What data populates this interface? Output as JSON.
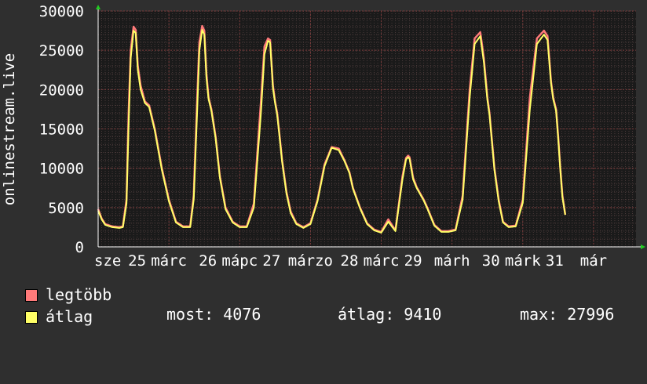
{
  "chart_data": {
    "type": "area",
    "ylabel": "onlinestream.live",
    "ylim": [
      0,
      30000
    ],
    "yticks": [
      0,
      5000,
      10000,
      15000,
      20000,
      25000,
      30000
    ],
    "xlim": [
      0,
      7.6
    ],
    "x_tick_labels": [
      {
        "x": 0.0,
        "label": "sze"
      },
      {
        "x": 0.55,
        "label": "25"
      },
      {
        "x": 1.0,
        "label": "márc"
      },
      {
        "x": 1.55,
        "label": "26"
      },
      {
        "x": 2.0,
        "label": "mápc"
      },
      {
        "x": 2.45,
        "label": "27"
      },
      {
        "x": 3.0,
        "label": "márzo"
      },
      {
        "x": 3.55,
        "label": "28"
      },
      {
        "x": 4.0,
        "label": "márc"
      },
      {
        "x": 4.45,
        "label": "29"
      },
      {
        "x": 5.0,
        "label": "márh"
      },
      {
        "x": 5.55,
        "label": "30"
      },
      {
        "x": 6.0,
        "label": "márk"
      },
      {
        "x": 6.45,
        "label": "31"
      },
      {
        "x": 7.0,
        "label": "már"
      }
    ],
    "x": [
      0.0,
      0.05,
      0.1,
      0.2,
      0.3,
      0.35,
      0.4,
      0.43,
      0.46,
      0.5,
      0.53,
      0.56,
      0.6,
      0.66,
      0.72,
      0.8,
      0.9,
      1.0,
      1.1,
      1.2,
      1.3,
      1.35,
      1.4,
      1.43,
      1.47,
      1.5,
      1.53,
      1.56,
      1.6,
      1.66,
      1.72,
      1.8,
      1.9,
      2.0,
      2.1,
      2.2,
      2.3,
      2.35,
      2.4,
      2.43,
      2.47,
      2.5,
      2.53,
      2.56,
      2.6,
      2.66,
      2.72,
      2.8,
      2.9,
      3.0,
      3.1,
      3.2,
      3.3,
      3.4,
      3.48,
      3.55,
      3.6,
      3.7,
      3.8,
      3.9,
      4.0,
      4.1,
      4.2,
      4.3,
      4.35,
      4.38,
      4.4,
      4.45,
      4.5,
      4.55,
      4.6,
      4.65,
      4.75,
      4.85,
      4.95,
      5.05,
      5.15,
      5.25,
      5.32,
      5.4,
      5.45,
      5.5,
      5.53,
      5.56,
      5.6,
      5.66,
      5.72,
      5.8,
      5.9,
      6.0,
      6.1,
      6.2,
      6.3,
      6.35,
      6.4,
      6.43,
      6.47,
      6.5,
      6.53,
      6.56,
      6.6,
      6.66,
      6.72,
      6.8,
      6.9,
      7.0,
      7.1
    ],
    "series": [
      {
        "name": "legtöbb",
        "color": "#ff7a7a",
        "values": [
          4800,
          3600,
          2900,
          2600,
          2500,
          2600,
          6000,
          17000,
          25000,
          28000,
          27600,
          23000,
          20500,
          18500,
          18000,
          15000,
          10000,
          6000,
          3200,
          2600,
          2600,
          6500,
          19000,
          26000,
          28100,
          27500,
          22000,
          19000,
          17500,
          14000,
          9000,
          5000,
          3200,
          2600,
          2600,
          5500,
          18500,
          25500,
          26500,
          26300,
          20500,
          18500,
          17000,
          14500,
          11000,
          7000,
          4500,
          3000,
          2500,
          3000,
          6000,
          10500,
          12700,
          12500,
          11000,
          9500,
          7500,
          5000,
          3000,
          2200,
          1900,
          3500,
          2100,
          9000,
          11300,
          11600,
          11400,
          8800,
          7600,
          6800,
          6000,
          5000,
          2800,
          2000,
          2000,
          2200,
          6500,
          20000,
          26500,
          27300,
          24000,
          19000,
          17000,
          14000,
          10000,
          6000,
          3200,
          2600,
          2700,
          6000,
          19000,
          26500,
          27500,
          26800,
          21000,
          19000,
          17500,
          14000,
          10000,
          6500,
          4100
        ]
      },
      {
        "name": "átlag",
        "color": "#ffff66",
        "values": [
          4600,
          3500,
          2800,
          2500,
          2400,
          2500,
          5500,
          15500,
          24000,
          27500,
          27200,
          22500,
          20000,
          18300,
          17800,
          14800,
          9800,
          5800,
          3100,
          2500,
          2500,
          6000,
          17500,
          25000,
          27600,
          27000,
          21500,
          18800,
          17300,
          13800,
          8800,
          4800,
          3100,
          2500,
          2500,
          5000,
          17000,
          24500,
          26200,
          26000,
          20200,
          18300,
          16800,
          14300,
          10800,
          6800,
          4300,
          2900,
          2400,
          2900,
          5800,
          10300,
          12600,
          12300,
          10900,
          9400,
          7400,
          4900,
          2900,
          2100,
          1800,
          3200,
          2000,
          8600,
          11100,
          11400,
          11200,
          8600,
          7500,
          6700,
          5900,
          4900,
          2700,
          1900,
          1900,
          2100,
          6000,
          19000,
          25800,
          26800,
          23500,
          18700,
          16800,
          13800,
          9800,
          5800,
          3100,
          2500,
          2600,
          5600,
          17500,
          25800,
          27000,
          26300,
          20800,
          18800,
          17300,
          13800,
          9800,
          6300,
          4076
        ]
      }
    ],
    "legend_placement": "bottom-left",
    "grid": true,
    "stats": {
      "most": "most: 4076",
      "atlag": "átlag: 9410",
      "max": "max: 27996"
    }
  },
  "legend": [
    {
      "label": "legtöbb",
      "color": "#ff7a7a"
    },
    {
      "label": "átlag",
      "color": "#ffff66"
    }
  ]
}
